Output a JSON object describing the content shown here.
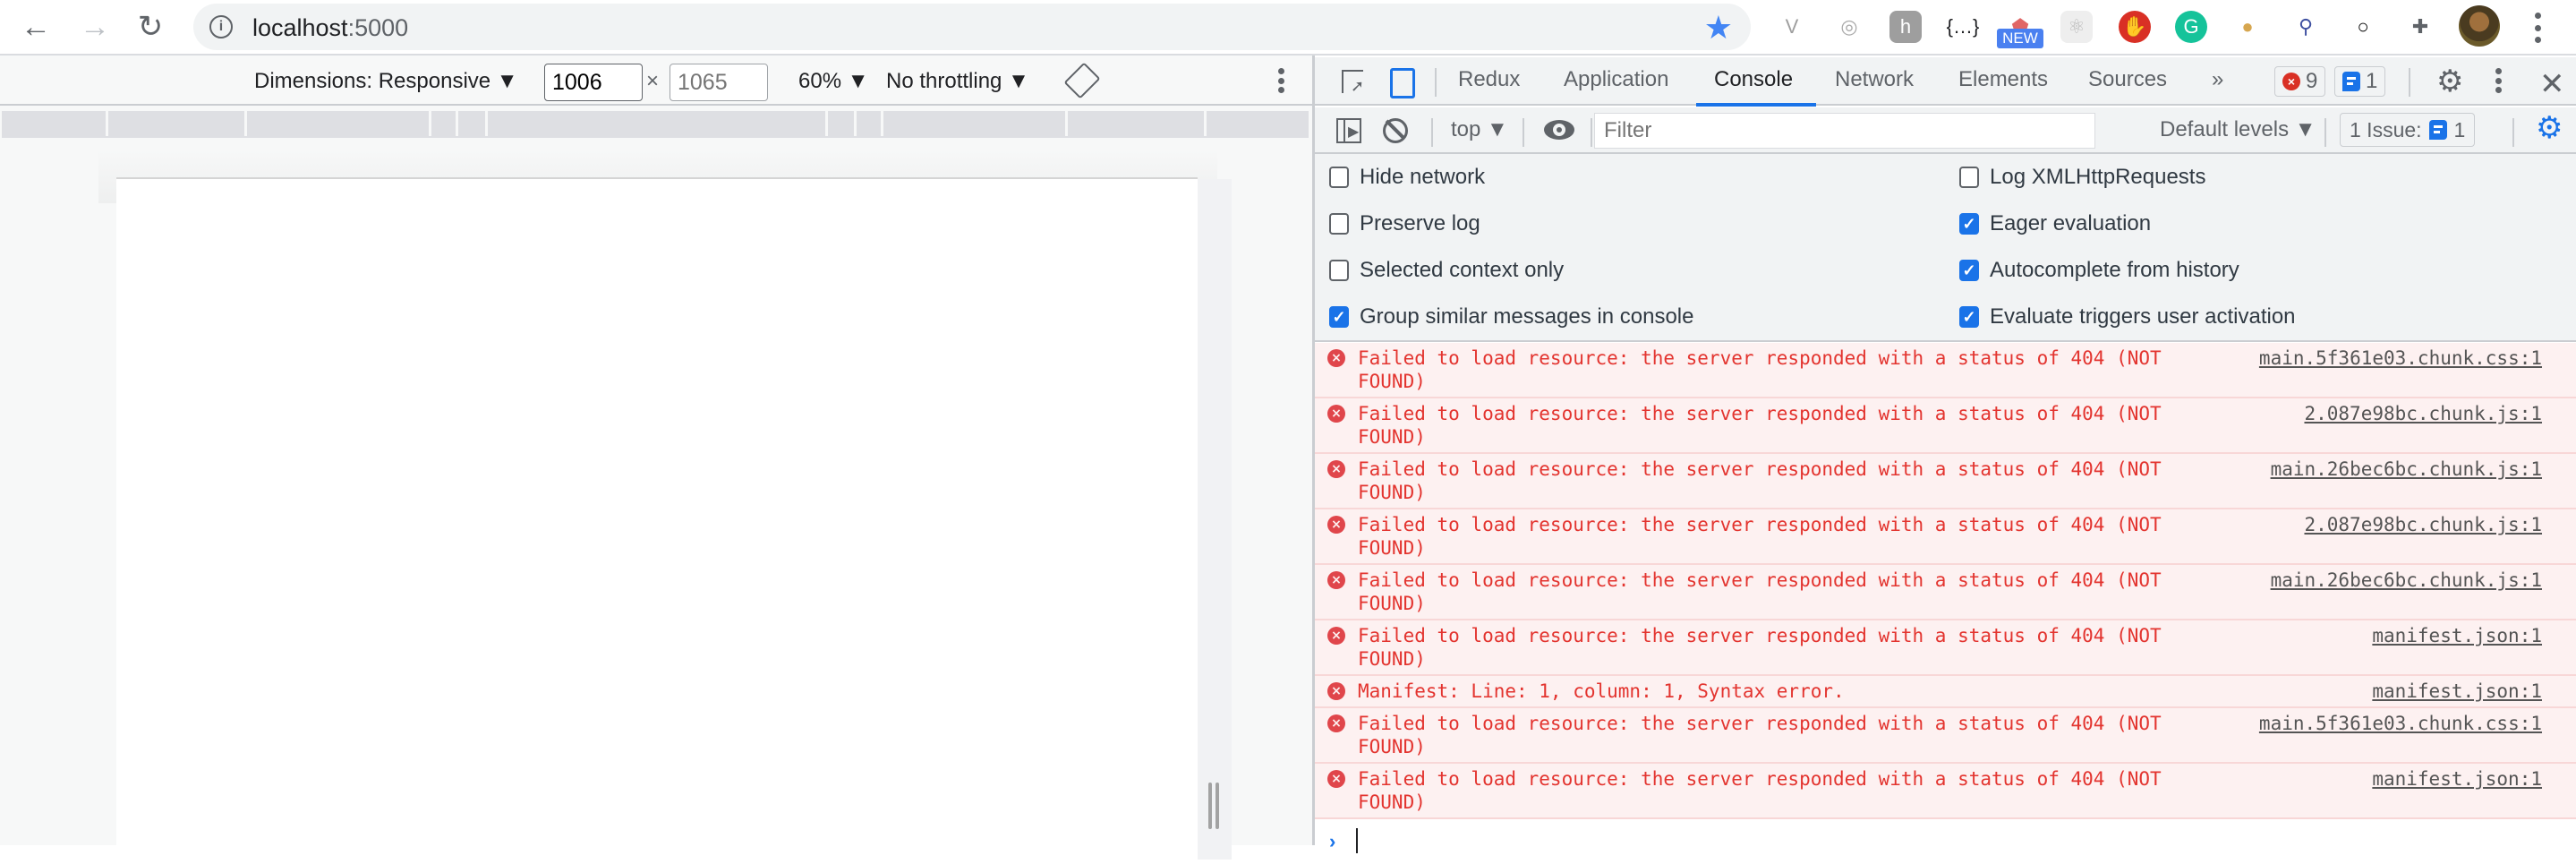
{
  "browser": {
    "url_host": "localhost",
    "url_port": ":5000",
    "extensions": [
      {
        "name": "vue-devtools-icon",
        "glyph": "V",
        "color": "#9e9e9e"
      },
      {
        "name": "ionic-icon",
        "glyph": "◎",
        "color": "#aaaaaa"
      },
      {
        "name": "hypothesis-icon",
        "glyph": "h",
        "color": "#ffffff"
      },
      {
        "name": "json-formatter-icon",
        "glyph": "{…}",
        "color": "#202124"
      },
      {
        "name": "ad-extension-icon",
        "glyph": "⬟",
        "color": "#e06666"
      },
      {
        "name": "react-devtools-icon",
        "glyph": "⚛",
        "color": "#bbbbbb"
      },
      {
        "name": "adblock-icon",
        "glyph": "✋",
        "color": "#ffffff"
      },
      {
        "name": "grammarly-icon",
        "glyph": "G",
        "color": "#ffffff"
      },
      {
        "name": "cookie-icon",
        "glyph": "●",
        "color": "#d6a64f"
      },
      {
        "name": "redux-devtools-icon",
        "glyph": "⚲",
        "color": "#3d4fa0"
      },
      {
        "name": "circle-extension-icon",
        "glyph": "○",
        "color": "#000000"
      },
      {
        "name": "extensions-puzzle-icon",
        "glyph": "✚",
        "color": "#5f6368"
      }
    ],
    "new_badge": "NEW"
  },
  "device_toolbar": {
    "dimensions_label": "Dimensions: Responsive ▼",
    "width_value": "1006",
    "times": "×",
    "height_placeholder": "1065",
    "zoom_label": "60% ▼",
    "throttling_label": "No throttling ▼"
  },
  "devtools": {
    "tabs": [
      {
        "label": "Redux",
        "active": false
      },
      {
        "label": "Application",
        "active": false
      },
      {
        "label": "Console",
        "active": true
      },
      {
        "label": "Network",
        "active": false
      },
      {
        "label": "Elements",
        "active": false
      },
      {
        "label": "Sources",
        "active": false
      }
    ],
    "more_tabs": "»",
    "error_count": "9",
    "message_count": "1",
    "console_toolbar": {
      "context": "top ▼",
      "filter_placeholder": "Filter",
      "levels": "Default levels ▼",
      "issues_label": "1 Issue:",
      "issues_count": "1"
    },
    "settings": [
      {
        "label": "Hide network",
        "checked": false
      },
      {
        "label": "Preserve log",
        "checked": false
      },
      {
        "label": "Selected context only",
        "checked": false
      },
      {
        "label": "Group similar messages in console",
        "checked": true
      },
      {
        "label": "Log XMLHttpRequests",
        "checked": false
      },
      {
        "label": "Eager evaluation",
        "checked": true
      },
      {
        "label": "Autocomplete from history",
        "checked": true
      },
      {
        "label": "Evaluate triggers user activation",
        "checked": true
      }
    ],
    "messages": [
      {
        "text": "Failed to load resource: the server responded with a status of 404 (NOT FOUND)",
        "source": "main.5f361e03.chunk.css:1",
        "level": "error"
      },
      {
        "text": "Failed to load resource: the server responded with a status of 404 (NOT FOUND)",
        "source": "2.087e98bc.chunk.js:1",
        "level": "error"
      },
      {
        "text": "Failed to load resource: the server responded with a status of 404 (NOT FOUND)",
        "source": "main.26bec6bc.chunk.js:1",
        "level": "error"
      },
      {
        "text": "Failed to load resource: the server responded with a status of 404 (NOT FOUND)",
        "source": "2.087e98bc.chunk.js:1",
        "level": "error"
      },
      {
        "text": "Failed to load resource: the server responded with a status of 404 (NOT FOUND)",
        "source": "main.26bec6bc.chunk.js:1",
        "level": "error"
      },
      {
        "text": "Failed to load resource: the server responded with a status of 404 (NOT FOUND)",
        "source": "manifest.json:1",
        "level": "error"
      },
      {
        "text": "Manifest: Line: 1, column: 1, Syntax error.",
        "source": "manifest.json:1",
        "level": "error"
      },
      {
        "text": "Failed to load resource: the server responded with a status of 404 (NOT FOUND)",
        "source": "main.5f361e03.chunk.css:1",
        "level": "error"
      },
      {
        "text": "Failed to load resource: the server responded with a status of 404 (NOT FOUND)",
        "source": "manifest.json:1",
        "level": "error"
      }
    ],
    "prompt_symbol": "›",
    "colors": {
      "accent": "#1a73e8",
      "error_text": "#e3342f",
      "error_bg": "#fdf1f1"
    }
  }
}
